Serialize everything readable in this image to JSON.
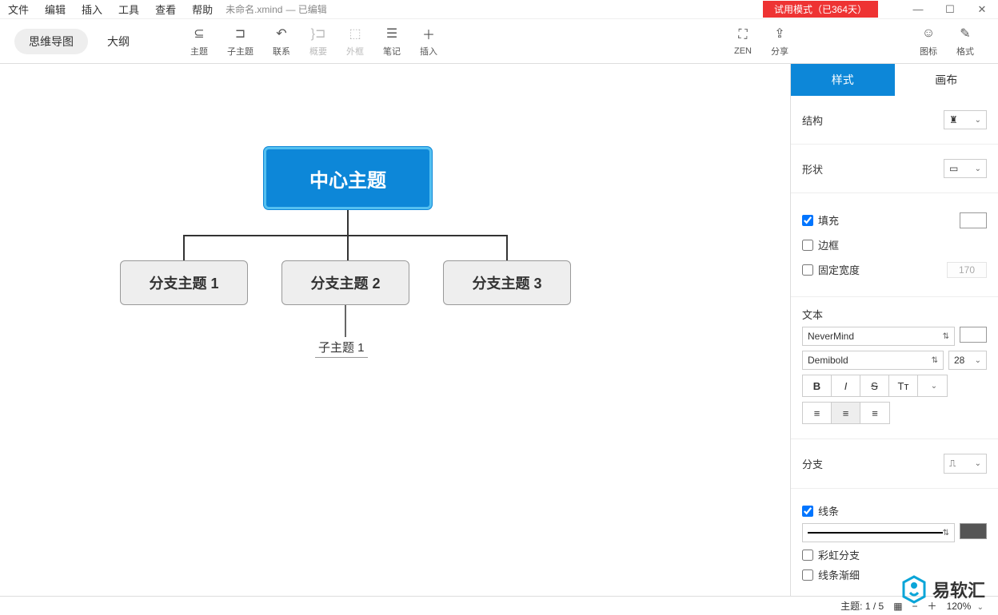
{
  "menus": {
    "file": "文件",
    "edit": "编辑",
    "insert": "插入",
    "tools": "工具",
    "view": "查看",
    "help": "帮助"
  },
  "doc": {
    "name": "未命名.xmind",
    "status": "— 已编辑"
  },
  "trial": "试用模式（已364天）",
  "viewTabs": {
    "mindmap": "思维导图",
    "outline": "大纲"
  },
  "tools": {
    "topic": "主题",
    "subtopic": "子主题",
    "relation": "联系",
    "summary": "概要",
    "boundary": "外框",
    "note": "笔记",
    "insert": "插入",
    "zen": "ZEN",
    "share": "分享",
    "icons": "图标",
    "format": "格式"
  },
  "nodes": {
    "center": "中心主题",
    "b1": "分支主题 1",
    "b2": "分支主题 2",
    "b3": "分支主题 3",
    "sub1": "子主题 1"
  },
  "panel": {
    "tabStyle": "样式",
    "tabCanvas": "画布",
    "structure": "结构",
    "shape": "形状",
    "fill": "填充",
    "border": "边框",
    "fixedWidth": "固定宽度",
    "fixedWidthVal": "170",
    "text": "文本",
    "fontFamily": "NeverMind",
    "fontWeight": "Demibold",
    "fontSize": "28",
    "branch": "分支",
    "line": "线条",
    "rainbow": "彩虹分支",
    "tapered": "线条渐细",
    "fillColor": "#0d87d8",
    "lineColor": "#555555"
  },
  "status": {
    "topic": "主题: 1 / 5",
    "zoom": "120%"
  },
  "watermark": "易软汇"
}
